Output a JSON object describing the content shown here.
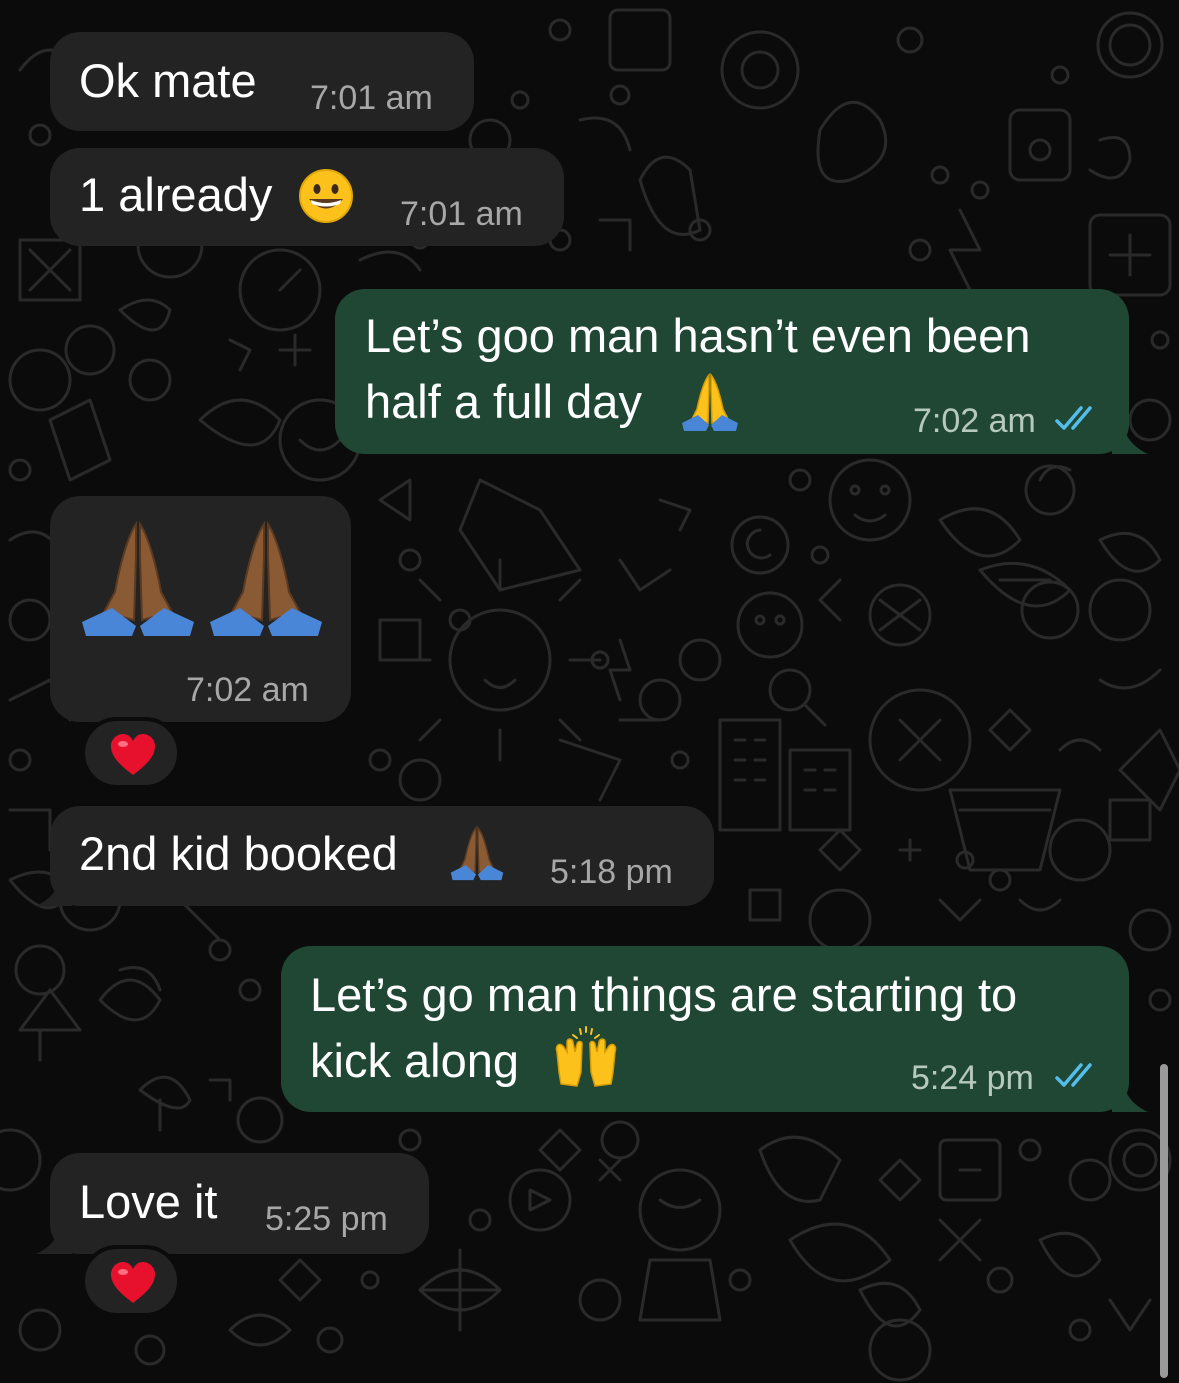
{
  "messages": [
    {
      "text": "Ok mate",
      "time": "7:01 am",
      "direction": "in"
    },
    {
      "text": "1 already",
      "emoji": "grinning-face-icon",
      "time": "7:01 am",
      "direction": "in"
    },
    {
      "line1": "Let’s goo man hasn’t even been",
      "line2": "half a full day",
      "emoji": "folded-hands-icon",
      "time": "7:02 am",
      "direction": "out",
      "status": "read"
    },
    {
      "emoji": "folded-hands-medium-dark-icon",
      "emoji_count": 2,
      "time": "7:02 am",
      "direction": "in",
      "reaction": "heart-icon"
    },
    {
      "text": "2nd kid booked",
      "emoji": "folded-hands-medium-dark-icon",
      "time": "5:18 pm",
      "direction": "in"
    },
    {
      "line1": "Let’s go man things are starting to",
      "line2": "kick along",
      "emoji": "raising-hands-icon",
      "time": "5:24 pm",
      "direction": "out",
      "status": "read"
    },
    {
      "text": "Love it",
      "time": "5:25 pm",
      "direction": "in",
      "reaction": "heart-icon"
    }
  ],
  "colors": {
    "background": "#0b0b0b",
    "incoming_bubble": "#232323",
    "outgoing_bubble": "#1f4733",
    "read_ticks": "#53bdeb",
    "heart": "#e8112d"
  }
}
